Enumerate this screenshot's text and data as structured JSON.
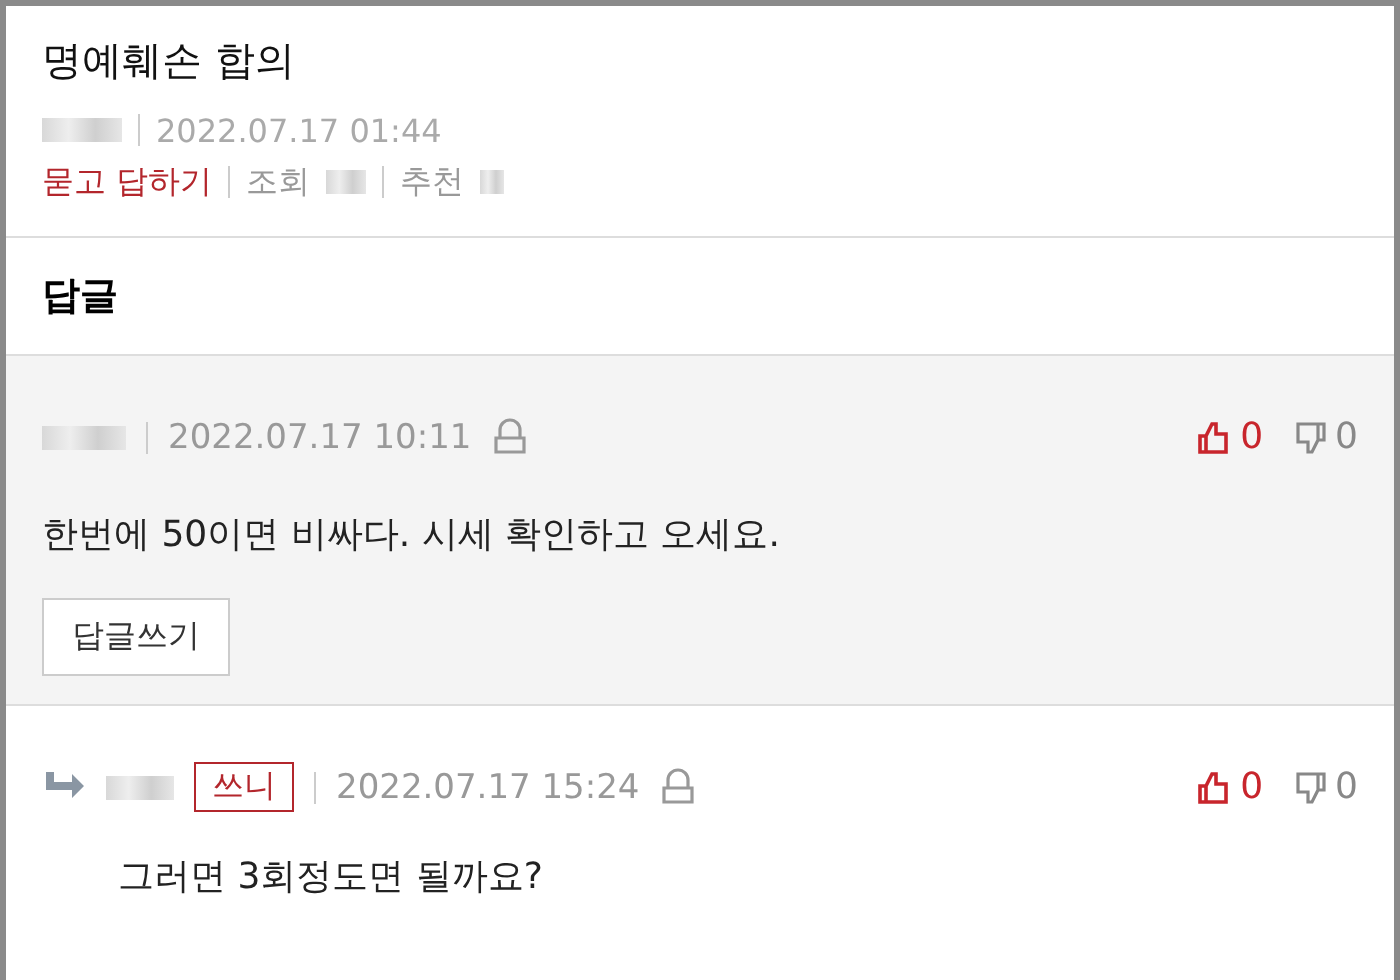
{
  "post": {
    "title": "명예훼손 합의",
    "date": "2022.07.17 01:44",
    "category": "묻고 답하기",
    "views_label": "조회",
    "recommend_label": "추천"
  },
  "replies_heading": "답글",
  "comments": [
    {
      "kind": "comment",
      "date": "2022.07.17 10:11",
      "text": "한번에 50이면 비싸다. 시세 확인하고 오세요.",
      "likes": "0",
      "dislikes": "0",
      "reply_button": "답글쓰기"
    },
    {
      "kind": "reply",
      "badge": "쓰니",
      "date": "2022.07.17 15:24",
      "text": "그러면 3회정도면 될까요?",
      "likes": "0",
      "dislikes": "0"
    }
  ]
}
